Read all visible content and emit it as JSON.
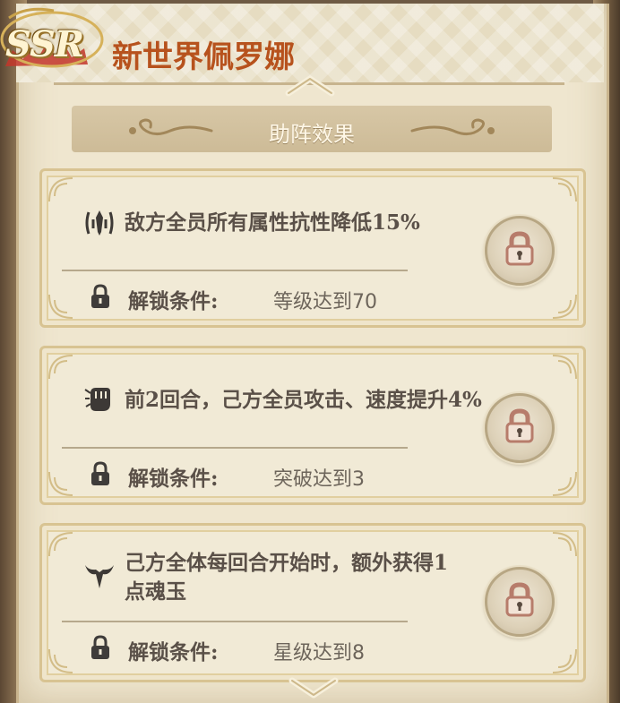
{
  "header": {
    "rarity": "SSR",
    "character_name": "新世界佩罗娜"
  },
  "section": {
    "title": "助阵效果"
  },
  "effects": [
    {
      "icon": "resistance-icon",
      "text": "敌方全员所有属性抗性降低15%",
      "condition_label": "解锁条件:",
      "condition_value": "等级达到70",
      "locked": true
    },
    {
      "icon": "fist-icon",
      "text": "前2回合，己方全员攻击、速度提升4%",
      "condition_label": "解锁条件:",
      "condition_value": "突破达到3",
      "locked": true
    },
    {
      "icon": "horned-helmet-icon",
      "text": "己方全体每回合开始时，额外获得1点魂玉",
      "condition_label": "解锁条件:",
      "condition_value": "星级达到8",
      "locked": true
    }
  ],
  "colors": {
    "name_color": "#b7521d",
    "parchment": "#efe6cf",
    "card_border": "#d8c392",
    "text_dark": "#5a5048"
  }
}
